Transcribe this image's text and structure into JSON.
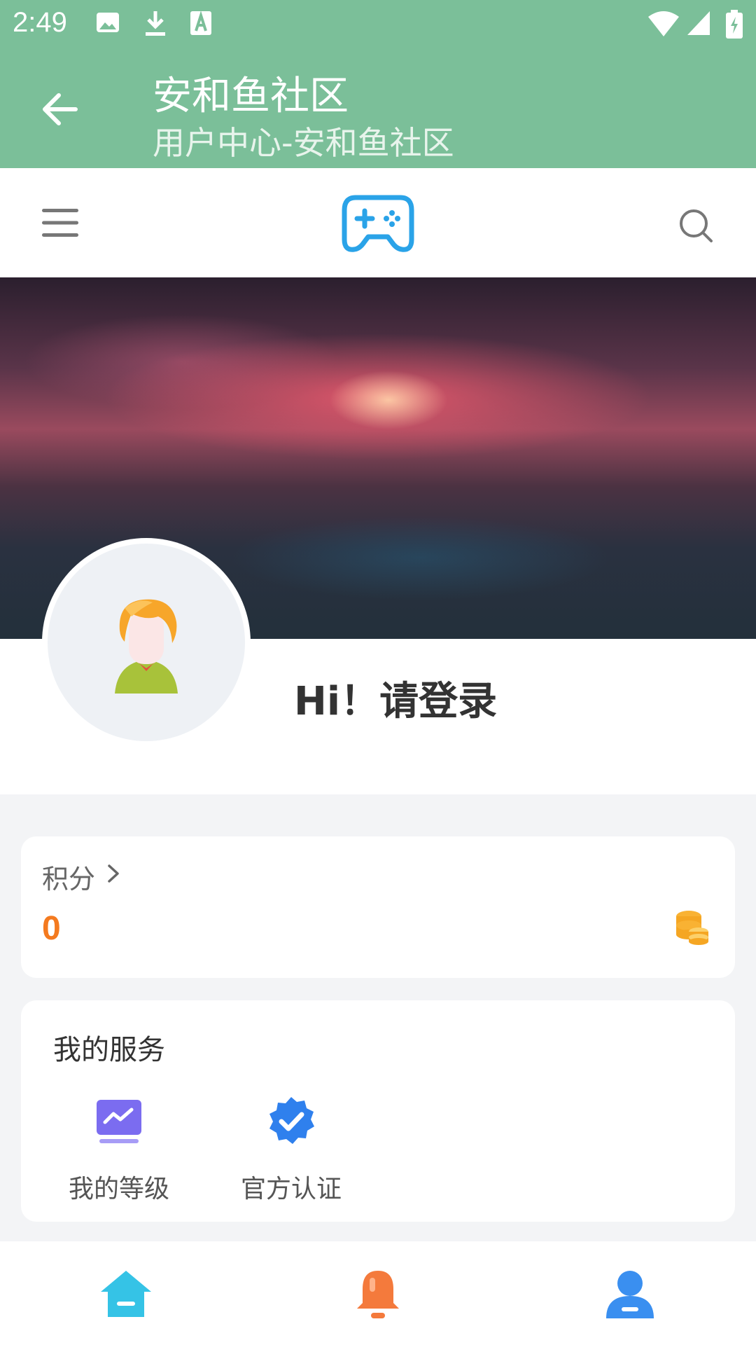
{
  "status_bar": {
    "time": "2:49",
    "icons": [
      "image-icon",
      "download-icon",
      "a-font-icon",
      "wifi-icon",
      "signal-icon",
      "battery-charging-icon"
    ]
  },
  "app_bar": {
    "title": "安和鱼社区",
    "subtitle": "用户中心-安和鱼社区",
    "background": "#7bbf99"
  },
  "top_nav": {
    "icons": [
      "menu-icon",
      "gamepad-logo-icon",
      "search-icon"
    ],
    "logo_color": "#2aa3e8"
  },
  "profile": {
    "greeting": "Hi！请登录"
  },
  "points": {
    "label": "积分",
    "value": "0",
    "value_color": "#f47a1f"
  },
  "services": {
    "title": "我的服务",
    "items": [
      {
        "label": "我的等级",
        "icon": "level-chart-icon"
      },
      {
        "label": "官方认证",
        "icon": "verified-badge-icon"
      }
    ]
  },
  "tab_bar": {
    "tabs": [
      {
        "icon": "home-icon",
        "color": "#35c3e6"
      },
      {
        "icon": "bell-icon",
        "color": "#f47a3c"
      },
      {
        "icon": "user-icon",
        "color": "#3a8ff0"
      }
    ]
  }
}
